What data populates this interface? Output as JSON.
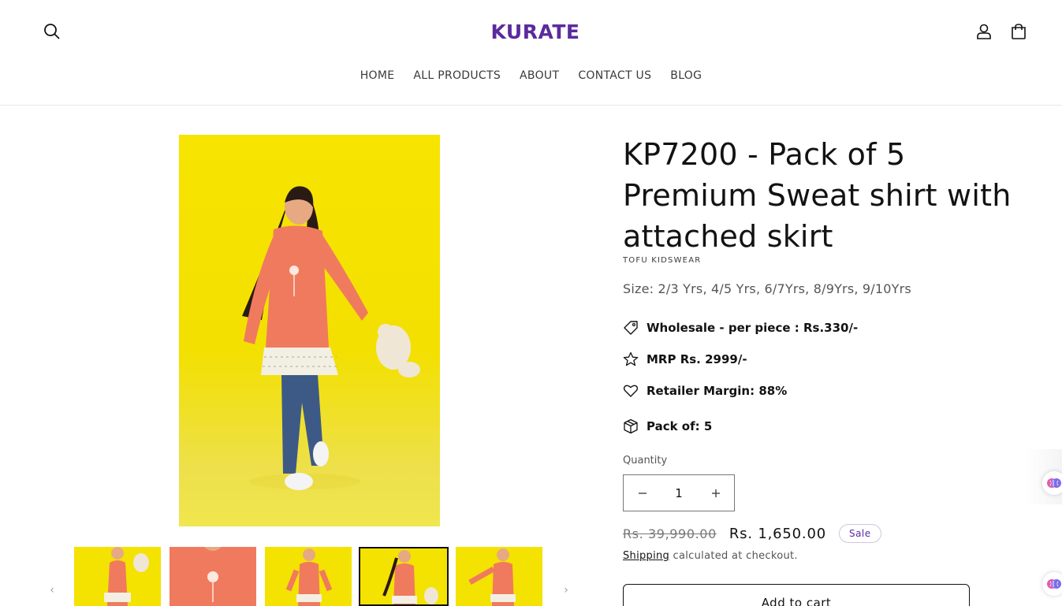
{
  "header": {
    "logo": "KURATE",
    "nav": [
      "HOME",
      "ALL PRODUCTS",
      "ABOUT",
      "CONTACT US",
      "BLOG"
    ],
    "icons": [
      "search-icon",
      "account-icon",
      "cart-icon"
    ]
  },
  "product": {
    "title": "KP7200 - Pack of 5 Premium Sweat shirt with attached skirt",
    "vendor": "TOFU KIDSWEAR",
    "sizes": "Size: 2/3 Yrs, 4/5 Yrs, 6/7Yrs, 8/9Yrs, 9/10Yrs",
    "features": {
      "wholesale_label": "Wholesale - per piece : ",
      "wholesale_value": "Rs.330/-",
      "mrp": "MRP Rs. 2999/-",
      "margin": "Retailer Margin: 88%",
      "pack": "Pack of: 5"
    },
    "quantity_label": "Quantity",
    "quantity_value": "1",
    "compare_price": "Rs. 39,990.00",
    "price": "Rs. 1,650.00",
    "badge": "Sale",
    "shipping_link": "Shipping",
    "shipping_text": " calculated at checkout.",
    "add_to_cart": "Add to cart"
  },
  "gallery": {
    "thumbnail_count": 5,
    "active_thumbnail": 4,
    "colors": {
      "background": "#f4e200",
      "sweatshirt": "#f07a5e"
    }
  },
  "colors": {
    "brand": "#5b2a9e",
    "text": "#121212",
    "muted": "#555555"
  }
}
